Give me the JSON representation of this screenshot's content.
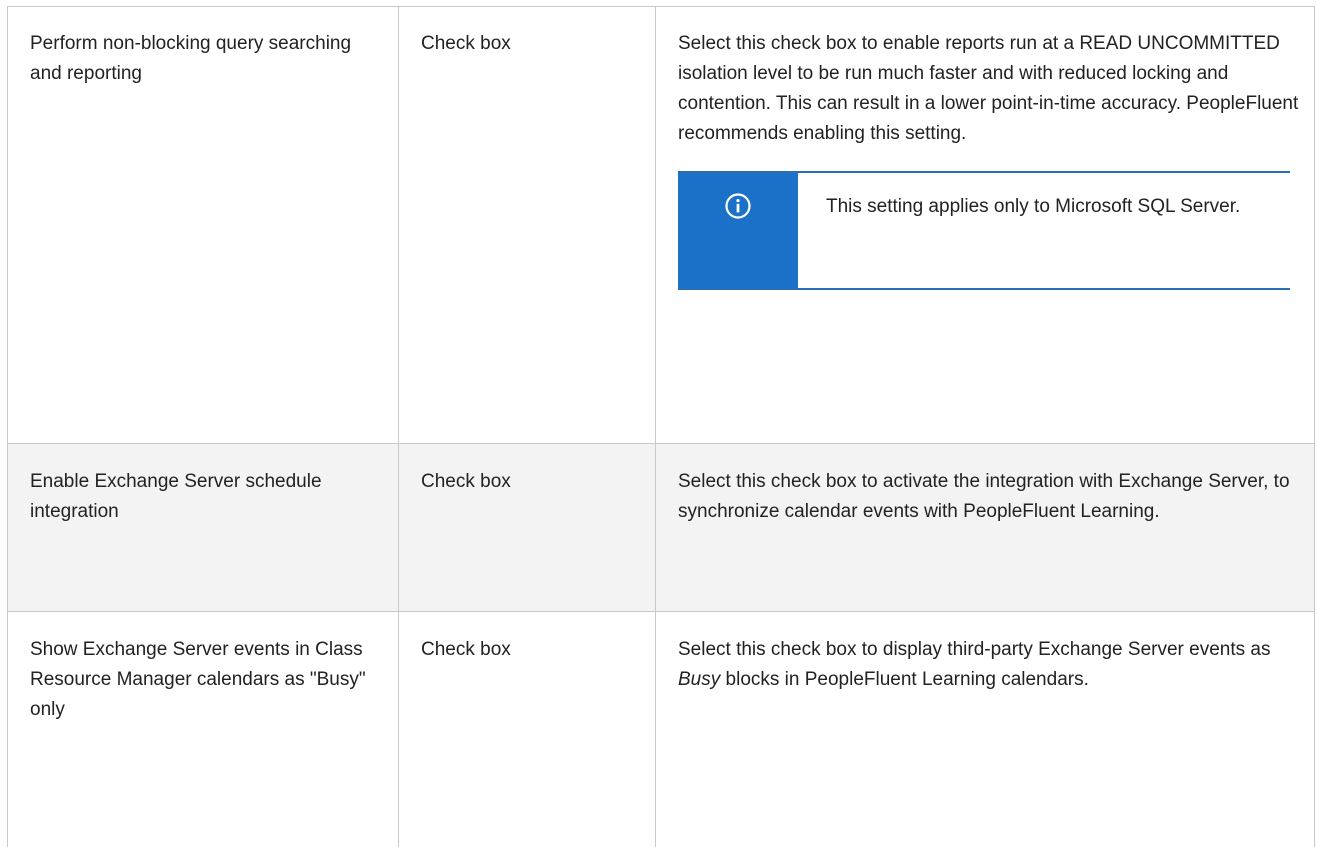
{
  "rows": [
    {
      "setting": "Perform non-blocking query searching and reporting",
      "type": "Check box",
      "description": "Select this check box to enable reports run at a READ UNCOMMITTED isolation level to be run much faster and with reduced locking and contention. This can result in a lower point-in-time accuracy. PeopleFluent recommends enabling this setting.",
      "note": {
        "icon": "info-icon",
        "text": "This setting applies only to Microsoft SQL Server."
      }
    },
    {
      "setting": "Enable Exchange Server schedule integration",
      "type": "Check box",
      "description": "Select this check box to activate the integration with Exchange Server, to synchronize calendar events with PeopleFluent Learning."
    },
    {
      "setting": "Show Exchange Server events in Class Resource Manager calendars as \"Busy\" only",
      "type": "Check box",
      "description_before": "Select this check box to display third-party Exchange Server events as ",
      "description_em": "Busy",
      "description_after": " blocks in PeopleFluent Learning calendars."
    }
  ],
  "colors": {
    "note_accent": "#1b70c8",
    "row_alt_bg": "#f3f3f3",
    "border": "#c9c9c9"
  }
}
